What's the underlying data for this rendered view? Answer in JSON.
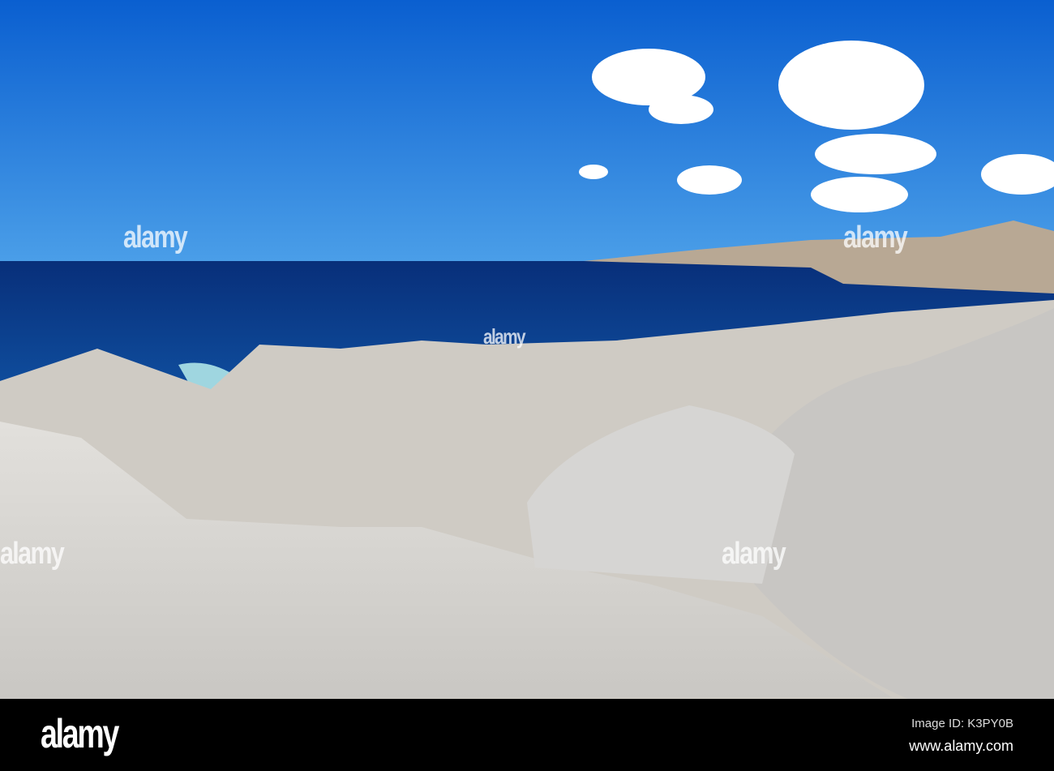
{
  "photo": {
    "description_alt": "Granite rocks by the sea",
    "watermark": "alamy",
    "colors": {
      "sky_top": "#0a5fd0",
      "sky_bottom": "#4a9ee8",
      "sea": "#0b3d8c",
      "rock": "#d8d6d2"
    }
  },
  "footer": {
    "logo": "alamy",
    "image_id": "Image ID: K3PY0B",
    "url": "www.alamy.com"
  }
}
